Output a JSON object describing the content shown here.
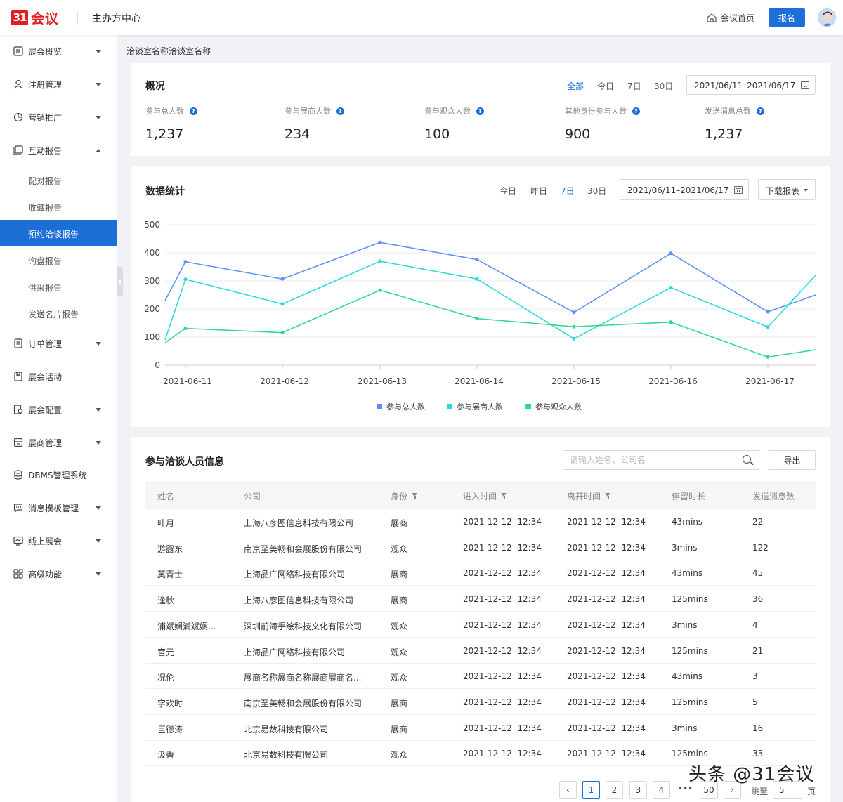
{
  "header": {
    "logo_mark": "31",
    "logo_text": "会议",
    "app_title": "主办方中心",
    "home_link": "会议首页",
    "signup_button": "报名"
  },
  "sidebar": {
    "items": [
      {
        "label": "展会概览",
        "icon": "overview-icon"
      },
      {
        "label": "注册管理",
        "icon": "user-icon"
      },
      {
        "label": "营销推广",
        "icon": "marketing-icon"
      },
      {
        "label": "互动报告",
        "icon": "report-icon",
        "expanded": true
      },
      {
        "label": "订单管理",
        "icon": "order-icon"
      },
      {
        "label": "展会活动",
        "icon": "activity-icon"
      },
      {
        "label": "展会配置",
        "icon": "config-icon"
      },
      {
        "label": "展商管理",
        "icon": "exhibitor-icon"
      },
      {
        "label": "DBMS管理系统",
        "icon": "database-icon"
      },
      {
        "label": "消息模板管理",
        "icon": "message-icon"
      },
      {
        "label": "线上展会",
        "icon": "online-icon"
      },
      {
        "label": "高级功能",
        "icon": "grid-icon"
      }
    ],
    "sub_items": [
      "配对报告",
      "收藏报告",
      "预约洽谈报告",
      "询盘报告",
      "供采报告",
      "发送名片报告"
    ],
    "active_sub": "预约洽谈报告"
  },
  "breadcrumb": "洽谈室名称洽谈室名称",
  "overview": {
    "title": "概况",
    "tabs": [
      "全部",
      "今日",
      "7日",
      "30日"
    ],
    "active_tab": "全部",
    "date_range": "2021/06/11–2021/06/17",
    "stats": [
      {
        "label": "参与总人数",
        "value": "1,237"
      },
      {
        "label": "参与展商人数",
        "value": "234"
      },
      {
        "label": "参与观众人数",
        "value": "100"
      },
      {
        "label": "其他身份参与人数",
        "value": "900"
      },
      {
        "label": "发送消息总数",
        "value": "1,237"
      }
    ]
  },
  "stats_card": {
    "title": "数据统计",
    "tabs": [
      "今日",
      "昨日",
      "7日",
      "30日"
    ],
    "active_tab": "7日",
    "date_range": "2021/06/11–2021/06/17",
    "download_button": "下载报表"
  },
  "chart_data": {
    "type": "line",
    "categories": [
      "2021-06-11",
      "2021-06-12",
      "2021-06-13",
      "2021-06-14",
      "2021-06-15",
      "2021-06-16",
      "2021-06-17"
    ],
    "ylim": [
      0,
      500
    ],
    "yticks": [
      "500",
      "400",
      "300",
      "200",
      "100",
      "0"
    ],
    "series": [
      {
        "name": "参与总人数",
        "color": "#5b8ff9",
        "start": 230,
        "values": [
          368,
          307,
          437,
          376,
          188,
          398,
          190
        ],
        "end": 250
      },
      {
        "name": "参与展商人数",
        "color": "#2ad9d9",
        "start": 90,
        "values": [
          306,
          218,
          370,
          307,
          94,
          276,
          136
        ],
        "end": 320
      },
      {
        "name": "参与观众人数",
        "color": "#2dd98a",
        "start": 80,
        "values": [
          131,
          116,
          267,
          166,
          137,
          153,
          29
        ],
        "end": 55
      }
    ],
    "legend_position": "bottom",
    "grid": true
  },
  "table_card": {
    "title": "参与洽谈人员信息",
    "search_placeholder": "请输入姓名、公司名",
    "export_button": "导出",
    "columns": [
      "姓名",
      "公司",
      "身份",
      "进入时间",
      "离开时间",
      "停留时长",
      "发送消息数"
    ],
    "rows": [
      [
        "叶月",
        "上海八彦图信息科技有限公司",
        "展商",
        "2021-12-12  12:34",
        "2021-12-12  12:34",
        "43mins",
        "22"
      ],
      [
        "游露东",
        "南京至美畅和会展股份有限公司",
        "观众",
        "2021-12-12  12:34",
        "2021-12-12  12:34",
        "3mins",
        "122"
      ],
      [
        "莫青士",
        "上海品广网络科技有限公司",
        "展商",
        "2021-12-12  12:34",
        "2021-12-12  12:34",
        "43mins",
        "45"
      ],
      [
        "逢秋",
        "上海八彦图信息科技有限公司",
        "展商",
        "2021-12-12  12:34",
        "2021-12-12  12:34",
        "125mins",
        "36"
      ],
      [
        "浦斌娴浦斌娴...",
        "深圳前海手绘科技文化有限公司",
        "观众",
        "2021-12-12  12:34",
        "2021-12-12  12:34",
        "3mins",
        "4"
      ],
      [
        "宫元",
        "上海品广网络科技有限公司",
        "观众",
        "2021-12-12  12:34",
        "2021-12-12  12:34",
        "125mins",
        "21"
      ],
      [
        "况伦",
        "展商名称展商名称展商展商名...",
        "观众",
        "2021-12-12  12:34",
        "2021-12-12  12:34",
        "43mins",
        "3"
      ],
      [
        "字欢时",
        "南京至美畅和会展股份有限公司",
        "展商",
        "2021-12-12  12:34",
        "2021-12-12  12:34",
        "125mins",
        "5"
      ],
      [
        "巨德涛",
        "北京易数科技有限公司",
        "展商",
        "2021-12-12  12:34",
        "2021-12-12  12:34",
        "3mins",
        "16"
      ],
      [
        "汲香",
        "北京易数科技有限公司",
        "观众",
        "2021-12-12  12:34",
        "2021-12-12  12:34",
        "125mins",
        "33"
      ]
    ]
  },
  "pagination": {
    "pages": [
      "1",
      "2",
      "3",
      "4"
    ],
    "active_page": "1",
    "ellipsis": "•••",
    "last_page": "50",
    "jump_label": "跳至",
    "jump_value": "5",
    "page_suffix": "页"
  },
  "watermark": "头条 @31会议"
}
